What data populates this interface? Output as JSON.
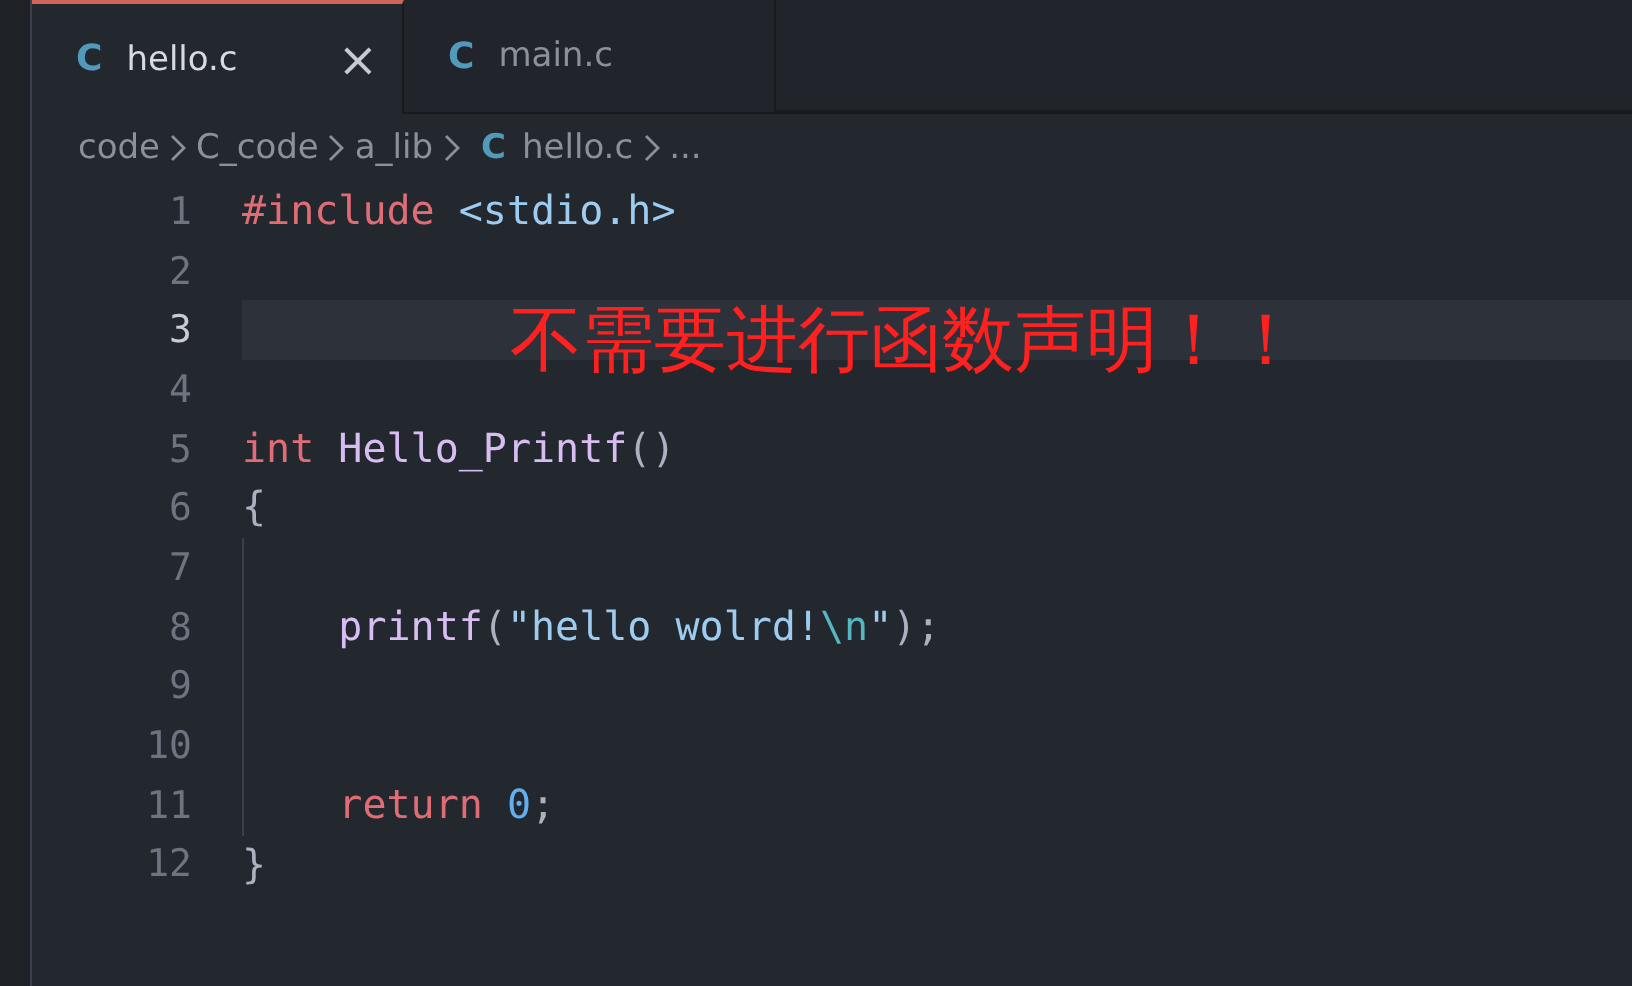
{
  "tabs": [
    {
      "icon": "C",
      "label": "hello.c",
      "close": "×",
      "selected": true
    },
    {
      "icon": "C",
      "label": "main.c",
      "selected": false
    }
  ],
  "breadcrumb": [
    {
      "label": "code"
    },
    {
      "label": "C_code"
    },
    {
      "label": "a_lib"
    },
    {
      "icon": "C",
      "label": "hello.c"
    },
    {
      "label": "..."
    }
  ],
  "lines": [
    {
      "number": "1",
      "current": false,
      "indented": false,
      "tokens": [
        {
          "kind": "keyword",
          "text": "#include"
        },
        {
          "kind": "include",
          "text": "<stdio.h>",
          "spaced": true
        }
      ]
    },
    {
      "number": "2",
      "current": false,
      "indented": false
    },
    {
      "number": "3",
      "current": true,
      "indented": false
    },
    {
      "number": "4",
      "current": false,
      "indented": false
    },
    {
      "number": "5",
      "current": false,
      "indented": false,
      "tokens": [
        {
          "kind": "keyword",
          "text": "int"
        },
        {
          "kind": "function",
          "text": "Hello_Printf",
          "spaced": true
        },
        {
          "kind": "punct",
          "text": "()"
        }
      ]
    },
    {
      "number": "6",
      "current": false,
      "indented": false,
      "tokens": [
        {
          "kind": "punct",
          "text": "{"
        }
      ]
    },
    {
      "number": "7",
      "current": false,
      "indented": true
    },
    {
      "number": "8",
      "current": false,
      "indented": true,
      "tokens": [
        {
          "kind": "function",
          "text": "printf"
        },
        {
          "kind": "punct",
          "text": "("
        },
        {
          "kind": "string",
          "text": "\"hello wolrd!"
        },
        {
          "kind": "escape",
          "text": "\\n"
        },
        {
          "kind": "string",
          "text": "\""
        },
        {
          "kind": "punct",
          "text": ");"
        }
      ]
    },
    {
      "number": "9",
      "current": false,
      "indented": true
    },
    {
      "number": "10",
      "current": false,
      "indented": true
    },
    {
      "number": "11",
      "current": false,
      "indented": true,
      "tokens": [
        {
          "kind": "keyword",
          "text": "return"
        },
        {
          "kind": "number",
          "text": "0",
          "spaced": true
        },
        {
          "kind": "punct",
          "text": ";"
        }
      ]
    },
    {
      "number": "12",
      "current": false,
      "indented": false,
      "tokens": [
        {
          "kind": "punct",
          "text": "}"
        }
      ]
    }
  ],
  "annotation": "不需要进行函数声明！！"
}
